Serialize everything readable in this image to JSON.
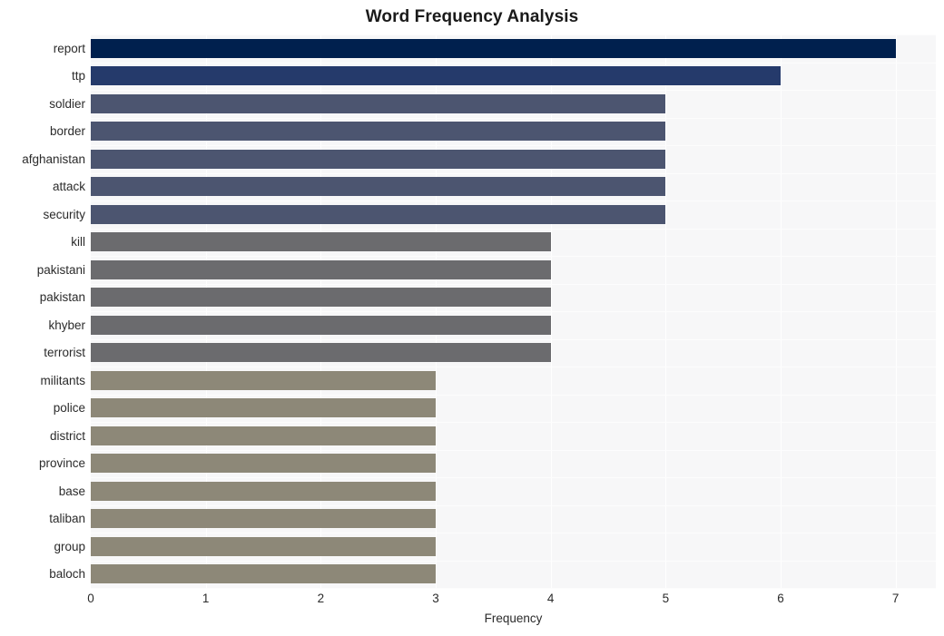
{
  "chart_data": {
    "type": "bar",
    "orientation": "horizontal",
    "title": "Word Frequency Analysis",
    "xlabel": "Frequency",
    "ylabel": "",
    "categories": [
      "report",
      "ttp",
      "soldier",
      "border",
      "afghanistan",
      "attack",
      "security",
      "kill",
      "pakistani",
      "pakistan",
      "khyber",
      "terrorist",
      "militants",
      "police",
      "district",
      "province",
      "base",
      "taliban",
      "group",
      "baloch"
    ],
    "values": [
      7,
      6,
      5,
      5,
      5,
      5,
      5,
      4,
      4,
      4,
      4,
      4,
      3,
      3,
      3,
      3,
      3,
      3,
      3,
      3
    ],
    "bar_colors": [
      "#00204e",
      "#253a6b",
      "#4c5570",
      "#4c5570",
      "#4c5570",
      "#4c5570",
      "#4c5570",
      "#6b6b6e",
      "#6b6b6e",
      "#6b6b6e",
      "#6b6b6e",
      "#6b6b6e",
      "#8d8878",
      "#8d8878",
      "#8d8878",
      "#8d8878",
      "#8d8878",
      "#8d8878",
      "#8d8878",
      "#8d8878"
    ],
    "xlim": [
      0,
      7.35
    ],
    "xticks": [
      0,
      1,
      2,
      3,
      4,
      5,
      6,
      7
    ],
    "xtick_labels": [
      "0",
      "1",
      "2",
      "3",
      "4",
      "5",
      "6",
      "7"
    ],
    "grid": true,
    "grid_color": "#ffffff",
    "legend": null,
    "plot_background": "#f7f7f8",
    "figure_background": "#ffffff"
  }
}
